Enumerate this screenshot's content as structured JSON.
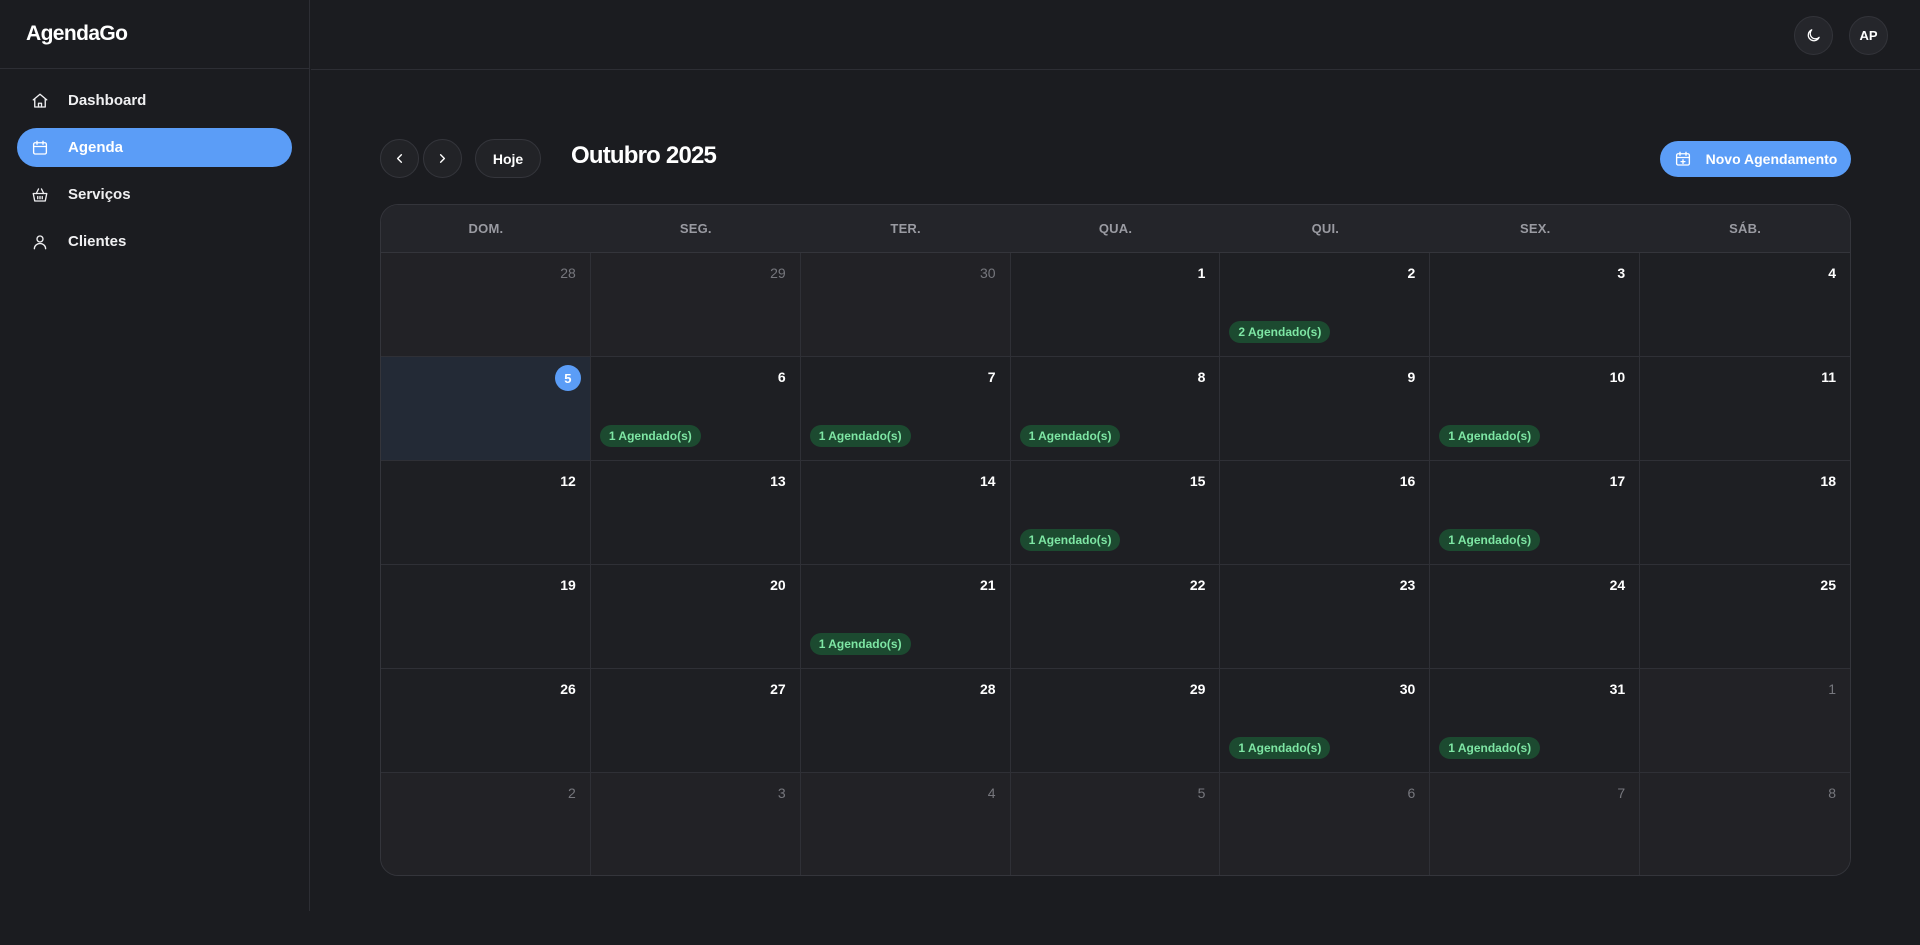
{
  "app": {
    "name": "AgendaGo"
  },
  "sidebar": {
    "items": [
      {
        "label": "Dashboard",
        "icon": "home-icon",
        "active": false
      },
      {
        "label": "Agenda",
        "icon": "calendar-icon",
        "active": true
      },
      {
        "label": "Serviços",
        "icon": "basket-icon",
        "active": false
      },
      {
        "label": "Clientes",
        "icon": "user-icon",
        "active": false
      }
    ]
  },
  "topbar": {
    "theme_icon": "moon-icon",
    "avatar_initials": "AP"
  },
  "toolbar": {
    "prev_icon": "chevron-left-icon",
    "next_icon": "chevron-right-icon",
    "today_label": "Hoje",
    "month_title": "Outubro 2025",
    "new_label": "Novo Agendamento",
    "new_icon": "calendar-plus-icon"
  },
  "calendar": {
    "weekdays": [
      "DOM.",
      "SEG.",
      "TER.",
      "QUA.",
      "QUI.",
      "SEX.",
      "SÁB."
    ],
    "weeks": [
      [
        {
          "day": "28",
          "outside": true
        },
        {
          "day": "29",
          "outside": true
        },
        {
          "day": "30",
          "outside": true
        },
        {
          "day": "1"
        },
        {
          "day": "2",
          "badge": "2 Agendado(s)"
        },
        {
          "day": "3"
        },
        {
          "day": "4"
        }
      ],
      [
        {
          "day": "5",
          "today": true
        },
        {
          "day": "6",
          "badge": "1 Agendado(s)"
        },
        {
          "day": "7",
          "badge": "1 Agendado(s)"
        },
        {
          "day": "8",
          "badge": "1 Agendado(s)"
        },
        {
          "day": "9"
        },
        {
          "day": "10",
          "badge": "1 Agendado(s)"
        },
        {
          "day": "11"
        }
      ],
      [
        {
          "day": "12"
        },
        {
          "day": "13"
        },
        {
          "day": "14"
        },
        {
          "day": "15",
          "badge": "1 Agendado(s)"
        },
        {
          "day": "16"
        },
        {
          "day": "17",
          "badge": "1 Agendado(s)"
        },
        {
          "day": "18"
        }
      ],
      [
        {
          "day": "19"
        },
        {
          "day": "20"
        },
        {
          "day": "21",
          "badge": "1 Agendado(s)"
        },
        {
          "day": "22"
        },
        {
          "day": "23"
        },
        {
          "day": "24"
        },
        {
          "day": "25"
        }
      ],
      [
        {
          "day": "26"
        },
        {
          "day": "27"
        },
        {
          "day": "28"
        },
        {
          "day": "29"
        },
        {
          "day": "30",
          "badge": "1 Agendado(s)"
        },
        {
          "day": "31",
          "badge": "1 Agendado(s)"
        },
        {
          "day": "1",
          "outside": true
        }
      ],
      [
        {
          "day": "2",
          "outside": true
        },
        {
          "day": "3",
          "outside": true
        },
        {
          "day": "4",
          "outside": true
        },
        {
          "day": "5",
          "outside": true
        },
        {
          "day": "6",
          "outside": true
        },
        {
          "day": "7",
          "outside": true
        },
        {
          "day": "8",
          "outside": true
        }
      ]
    ]
  },
  "colors": {
    "accent": "#5b9df7",
    "badge_bg": "#1c4a30",
    "badge_text": "#7ee6a4",
    "background": "#1b1c20"
  }
}
